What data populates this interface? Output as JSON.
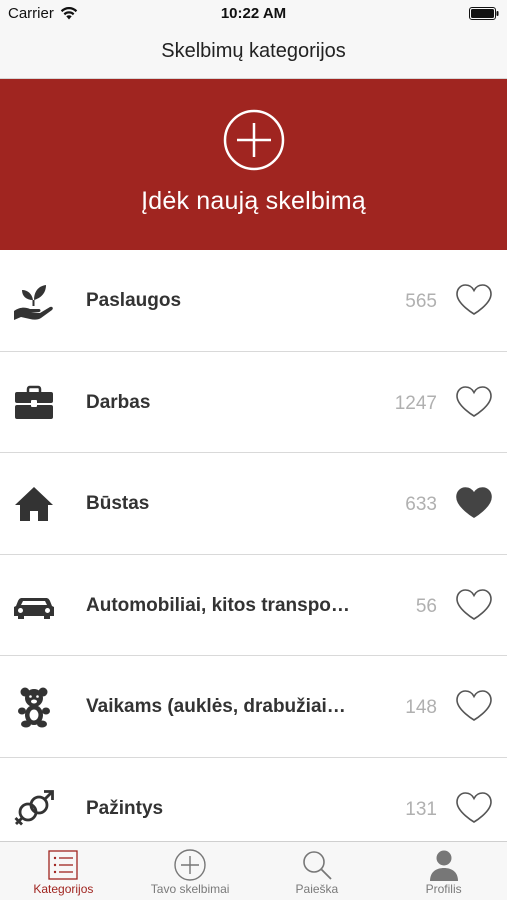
{
  "status_bar": {
    "carrier": "Carrier",
    "time": "10:22 AM"
  },
  "nav": {
    "title": "Skelbimų kategorijos"
  },
  "banner": {
    "label": "Įdėk naują skelbimą",
    "icon": "plus-circle-icon"
  },
  "categories": [
    {
      "label": "Paslaugos",
      "count": "565",
      "icon": "hand-plant-icon",
      "favorited": false
    },
    {
      "label": "Darbas",
      "count": "1247",
      "icon": "briefcase-icon",
      "favorited": false
    },
    {
      "label": "Būstas",
      "count": "633",
      "icon": "house-icon",
      "favorited": true
    },
    {
      "label": "Automobiliai, kitos transpo…",
      "count": "56",
      "icon": "car-icon",
      "favorited": false
    },
    {
      "label": "Vaikams (auklės, drabužiai…",
      "count": "148",
      "icon": "teddy-bear-icon",
      "favorited": false
    },
    {
      "label": "Pažintys",
      "count": "131",
      "icon": "gender-symbols-icon",
      "favorited": false
    }
  ],
  "tab_bar": {
    "tabs": [
      {
        "label": "Kategorijos",
        "icon": "list-icon",
        "active": true
      },
      {
        "label": "Tavo skelbimai",
        "icon": "plus-circle-icon",
        "active": false
      },
      {
        "label": "Paieška",
        "icon": "search-icon",
        "active": false
      },
      {
        "label": "Profilis",
        "icon": "person-icon",
        "active": false
      }
    ]
  },
  "colors": {
    "accent": "#a02520",
    "icon": "#333333",
    "count": "#b0b0b0"
  }
}
